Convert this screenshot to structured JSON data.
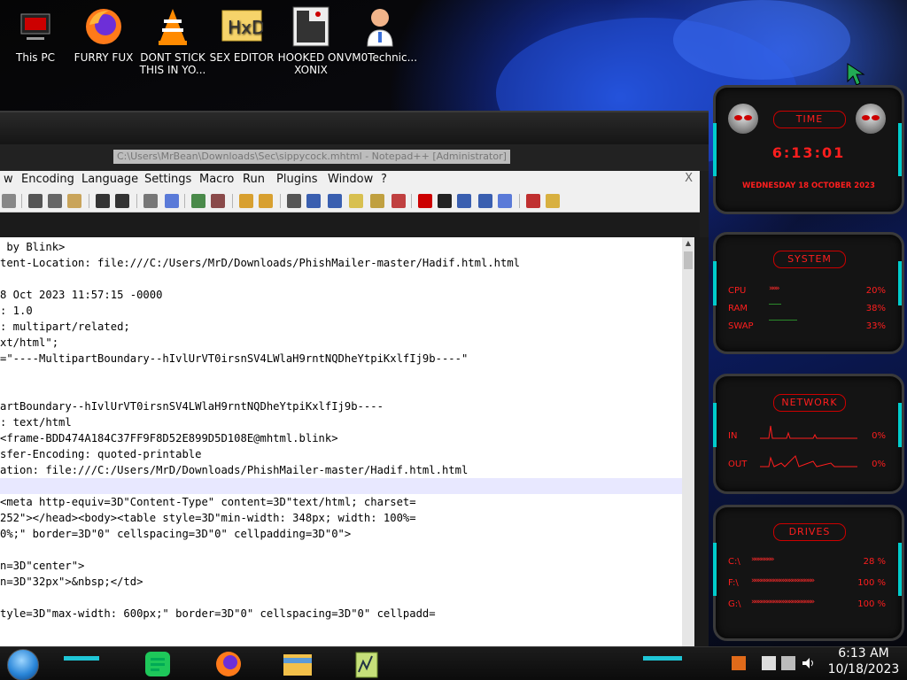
{
  "desktop": {
    "icons": [
      {
        "label": "This PC",
        "icon": "this-pc-icon"
      },
      {
        "label": "FURRY FUX",
        "icon": "firefox-icon"
      },
      {
        "label": "DONT STICK THIS IN YO...",
        "icon": "vlc-icon"
      },
      {
        "label": "SEX EDITOR",
        "icon": "hxd-editor-icon"
      },
      {
        "label": "HOOKED ON XONIX",
        "icon": "xonix-game-icon"
      },
      {
        "label": "VM0Technic...",
        "icon": "doctor-icon"
      }
    ]
  },
  "editor_window": {
    "title": "C:\\Users\\MrBean\\Downloads\\Sec\\sippycock.mhtml - Notepad++ [Administrator]",
    "menu": [
      "w",
      "Encoding",
      "Language",
      "Settings",
      "Macro",
      "Run",
      "Plugins",
      "Window",
      "?"
    ],
    "close_label": "X",
    "lines": [
      " by Blink>",
      "tent-Location: file:///C:/Users/MrD/Downloads/PhishMailer-master/Hadif.html.html",
      "",
      "8 Oct 2023 11:57:15 -0000",
      ": 1.0",
      ": multipart/related;",
      "xt/html\";",
      "=\"----MultipartBoundary--hIvlUrVT0irsnSV4LWlaH9rntNQDheYtpiKxlfIj9b----\"",
      "",
      "",
      "artBoundary--hIvlUrVT0irsnSV4LWlaH9rntNQDheYtpiKxlfIj9b----",
      ": text/html",
      "<frame-BDD474A184C37FF9F8D52E899D5D108E@mhtml.blink>",
      "sfer-Encoding: quoted-printable",
      "ation: file:///C:/Users/MrD/Downloads/PhishMailer-master/Hadif.html.html",
      "",
      "<meta http-equiv=3D\"Content-Type\" content=3D\"text/html; charset=",
      "252\"></head><body><table style=3D\"min-width: 348px; width: 100%=",
      "0%;\" border=3D\"0\" cellspacing=3D\"0\" cellpadding=3D\"0\">",
      "",
      "n=3D\"center\">",
      "n=3D\"32px\">&nbsp;</td>",
      "",
      "tyle=3D\"max-width: 600px;\" border=3D\"0\" cellspacing=3D\"0\" cellpadd="
    ]
  },
  "widgets": {
    "time": {
      "header": "TIME",
      "clock": "6:13:01",
      "date": "WEDNESDAY 18 OCTOBER 2023"
    },
    "system": {
      "header": "SYSTEM",
      "rows": [
        {
          "label": "CPU",
          "value": "20%"
        },
        {
          "label": "RAM",
          "value": "38%"
        },
        {
          "label": "SWAP",
          "value": "33%"
        }
      ]
    },
    "network": {
      "header": "NETWORK",
      "rows": [
        {
          "label": "IN",
          "value": "0%"
        },
        {
          "label": "OUT",
          "value": "0%"
        }
      ]
    },
    "drives": {
      "header": "DRIVES",
      "rows": [
        {
          "label": "C:\\",
          "value": "28 %"
        },
        {
          "label": "F:\\",
          "value": "100 %"
        },
        {
          "label": "G:\\",
          "value": "100 %"
        }
      ]
    },
    "accent_color": "#ff1e1e"
  },
  "taskbar": {
    "time": "6:13 AM",
    "date": "10/18/2023",
    "apps": [
      "notes-app-icon",
      "firefox-icon",
      "file-explorer-icon",
      "notepad-plus-plus-icon"
    ],
    "tray": [
      "matlab-icon",
      "action-center-icon",
      "network-icon",
      "volume-icon"
    ]
  }
}
